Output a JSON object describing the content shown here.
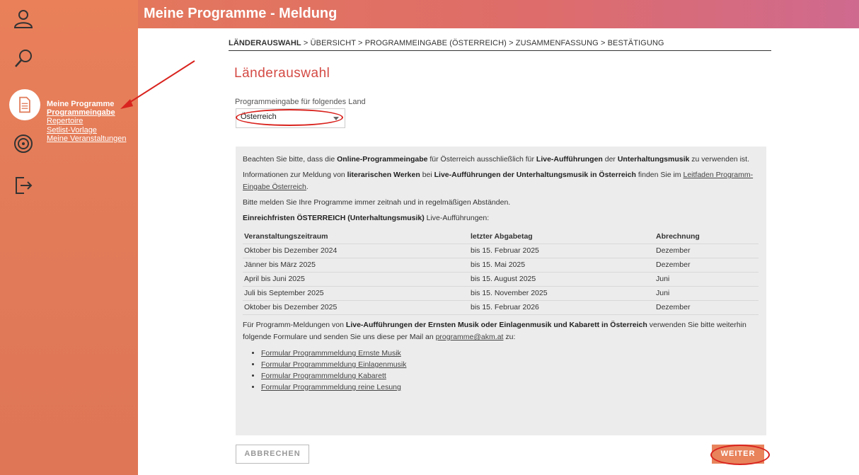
{
  "header": {
    "title": "Meine Programme - Meldung"
  },
  "sidebar": {
    "icons": [
      "user-icon",
      "search-icon",
      "document-icon",
      "disc-icon",
      "logout-icon"
    ],
    "submenu": {
      "title": "Meine Programme",
      "items": [
        {
          "label": "Programmeingabe",
          "active": true
        },
        {
          "label": "Repertoire",
          "active": false
        },
        {
          "label": "Setlist-Vorlage",
          "active": false
        },
        {
          "label": "Meine Veranstaltungen",
          "active": false
        }
      ]
    }
  },
  "breadcrumb": {
    "steps": [
      "LÄNDERAUSWAHL",
      "ÜBERSICHT",
      "PROGRAMMEINGABE (ÖSTERREICH)",
      "ZUSAMMENFASSUNG",
      "BESTÄTIGUNG"
    ],
    "separator": ">"
  },
  "main": {
    "title": "Länderauswahl",
    "country_label": "Programmeingabe für folgendes Land",
    "country_value": "Österreich",
    "info": {
      "p1_a": "Beachten Sie bitte, dass die ",
      "p1_b": "Online-Programmeingabe",
      "p1_c": " für Österreich ausschließlich für ",
      "p1_d": "Live-Aufführungen",
      "p1_e": " der ",
      "p1_f": "Unterhaltungsmusik",
      "p1_g": " zu verwenden ist.",
      "p2_a": "Informationen zur Meldung von ",
      "p2_b": "literarischen Werken",
      "p2_c": " bei ",
      "p2_d": "Live-Aufführungen der Unterhaltungsmusik in Österreich",
      "p2_e": " finden Sie im ",
      "p2_link": "Leitfaden Programm-Eingabe Österreich",
      "p2_f": ".",
      "p3": "Bitte melden Sie Ihre Programme immer zeitnah und in regelmäßigen Abständen.",
      "p4_a": "Einreichfristen ÖSTERREICH (Unterhaltungsmusik)",
      "p4_b": " Live-Aufführungen:",
      "table": {
        "headers": [
          "Veranstaltungszeitraum",
          "letzter Abgabetag",
          "Abrechnung"
        ],
        "rows": [
          [
            "Oktober bis Dezember 2024",
            "bis 15. Februar 2025",
            "Dezember"
          ],
          [
            "Jänner bis März 2025",
            "bis 15. Mai 2025",
            "Dezember"
          ],
          [
            "April bis Juni 2025",
            "bis 15. August 2025",
            "Juni"
          ],
          [
            "Juli bis September 2025",
            "bis 15. November 2025",
            "Juni"
          ],
          [
            "Oktober bis Dezember 2025",
            "bis 15. Februar 2026",
            "Dezember"
          ]
        ]
      },
      "p5_a": "Für Programm-Meldungen von ",
      "p5_b": "Live-Aufführungen der Ernsten Musik oder Einlagenmusik und Kabarett in Österreich",
      "p5_c": " verwenden Sie bitte weiterhin folgende Formulare und senden Sie uns diese per Mail an ",
      "p5_link": "programme@akm.at",
      "p5_d": " zu:",
      "forms": [
        "Formular Programmmeldung Ernste Musik",
        "Formular Programmmeldung Einlagenmusik",
        "Formular Programmmeldung Kabarett",
        "Formular Programmmeldung reine Lesung"
      ]
    },
    "cancel_label": "ABBRECHEN",
    "next_label": "WEITER"
  },
  "colors": {
    "accent": "#e8835c",
    "title_red": "#d44a44",
    "annotation_red": "#d9231e",
    "panel_bg": "#ececec"
  }
}
